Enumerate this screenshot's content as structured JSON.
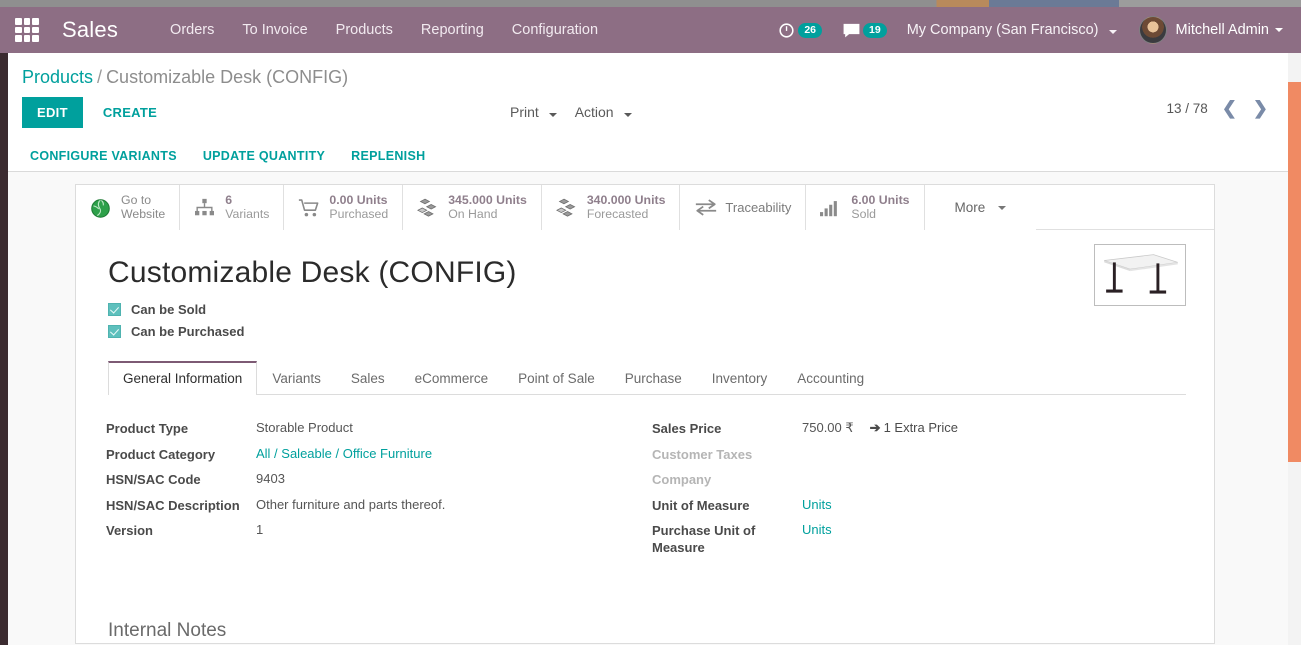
{
  "navbar": {
    "apps_icon": "apps-grid-icon",
    "brand": "Sales",
    "menu": [
      "Orders",
      "To Invoice",
      "Products",
      "Reporting",
      "Configuration"
    ],
    "activity": {
      "icon": "clock-icon",
      "count": "26"
    },
    "messaging": {
      "icon": "chat-bubble-icon",
      "count": "19"
    },
    "company": "My Company (San Francisco)",
    "user": "Mitchell Admin",
    "accent": "#8d6e84"
  },
  "control_panel": {
    "breadcrumb_root": "Products",
    "breadcrumb_sep": "/",
    "breadcrumb_current": "Customizable Desk (CONFIG)",
    "edit_label": "EDIT",
    "create_label": "CREATE",
    "print_label": "Print",
    "action_label": "Action",
    "pager": "13 / 78",
    "prev_icon": "chevron-left-icon",
    "next_icon": "chevron-right-icon",
    "primary_color": "#00A09D"
  },
  "sub_bar": {
    "buttons": [
      "CONFIGURE VARIANTS",
      "UPDATE QUANTITY",
      "REPLENISH"
    ]
  },
  "stat_buttons": [
    {
      "icon": "globe-icon",
      "value": "",
      "label": "Go to",
      "label2": "Website"
    },
    {
      "icon": "sitemap-icon",
      "value": "6",
      "label": "Variants",
      "label2": ""
    },
    {
      "icon": "cart-icon",
      "value": "0.00 Units",
      "label": "Purchased",
      "label2": ""
    },
    {
      "icon": "boxes-icon",
      "value": "345.000 Units",
      "label": "On Hand",
      "label2": ""
    },
    {
      "icon": "boxes-icon",
      "value": "340.000 Units",
      "label": "Forecasted",
      "label2": ""
    },
    {
      "icon": "exchange-icon",
      "value": "",
      "label": "Traceability",
      "label2": ""
    },
    {
      "icon": "bar-chart-icon",
      "value": "6.00 Units",
      "label": "Sold",
      "label2": ""
    }
  ],
  "more_button": {
    "label": "More",
    "icon": "caret-down-icon"
  },
  "product": {
    "title": "Customizable Desk (CONFIG)",
    "image_alt": "white office desk with black legs",
    "can_be_sold": "Can be Sold",
    "can_be_purchased": "Can be Purchased",
    "can_be_sold_checked": true,
    "can_be_purchased_checked": true
  },
  "tabs": [
    {
      "label": "General Information",
      "active": true
    },
    {
      "label": "Variants",
      "active": false
    },
    {
      "label": "Sales",
      "active": false
    },
    {
      "label": "eCommerce",
      "active": false
    },
    {
      "label": "Point of Sale",
      "active": false
    },
    {
      "label": "Purchase",
      "active": false
    },
    {
      "label": "Inventory",
      "active": false
    },
    {
      "label": "Accounting",
      "active": false
    }
  ],
  "form": {
    "left": [
      {
        "label": "Product Type",
        "value": "Storable Product",
        "link": false
      },
      {
        "label": "Product Category",
        "value": "All / Saleable / Office Furniture",
        "link": true
      },
      {
        "label": "HSN/SAC Code",
        "value": "9403",
        "link": false
      },
      {
        "label": "HSN/SAC Description",
        "value": "Other furniture and parts thereof.",
        "link": false
      },
      {
        "label": "Version",
        "value": "1",
        "link": false
      }
    ],
    "sales_price_label": "Sales Price",
    "sales_price_value": "750.00 ₹",
    "extra_price_label": "1 Extra Price",
    "extra_price_arrow": "➔",
    "customer_taxes_label": "Customer Taxes",
    "customer_taxes_value": "",
    "company_label": "Company",
    "company_value": "",
    "uom_label": "Unit of Measure",
    "uom_value": "Units",
    "purchase_uom_label": "Purchase Unit of Measure",
    "purchase_uom_value": "Units"
  },
  "internal_notes_title": "Internal Notes",
  "scrollbar": {
    "name": "vertical-scrollbar",
    "color": "#f08a63"
  }
}
